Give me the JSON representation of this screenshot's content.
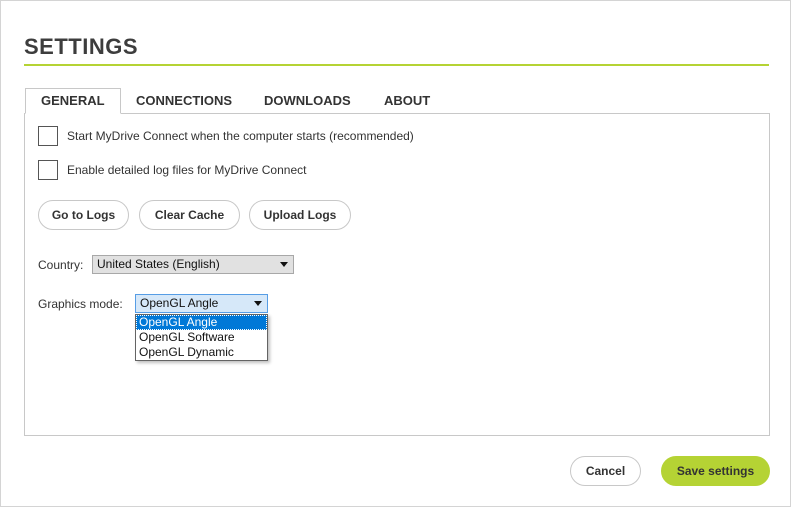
{
  "title": "SETTINGS",
  "tabs": [
    {
      "label": "GENERAL"
    },
    {
      "label": "CONNECTIONS"
    },
    {
      "label": "DOWNLOADS"
    },
    {
      "label": "ABOUT"
    }
  ],
  "active_tab": "GENERAL",
  "general": {
    "checkboxes": [
      {
        "label": "Start MyDrive Connect when the computer starts (recommended)",
        "checked": false
      },
      {
        "label": "Enable detailed log files for MyDrive Connect",
        "checked": false
      }
    ],
    "buttons": {
      "go_to_logs": "Go to Logs",
      "clear_cache": "Clear Cache",
      "upload_logs": "Upload Logs"
    },
    "country": {
      "label": "Country:",
      "value": "United States (English)"
    },
    "graphics_mode": {
      "label": "Graphics mode:",
      "value": "OpenGL Angle",
      "options": [
        "OpenGL Angle",
        "OpenGL Software",
        "OpenGL Dynamic"
      ],
      "highlighted": "OpenGL Angle"
    }
  },
  "footer": {
    "cancel": "Cancel",
    "save": "Save settings"
  },
  "colors": {
    "accent": "#b5d334",
    "selection": "#0078d7"
  }
}
